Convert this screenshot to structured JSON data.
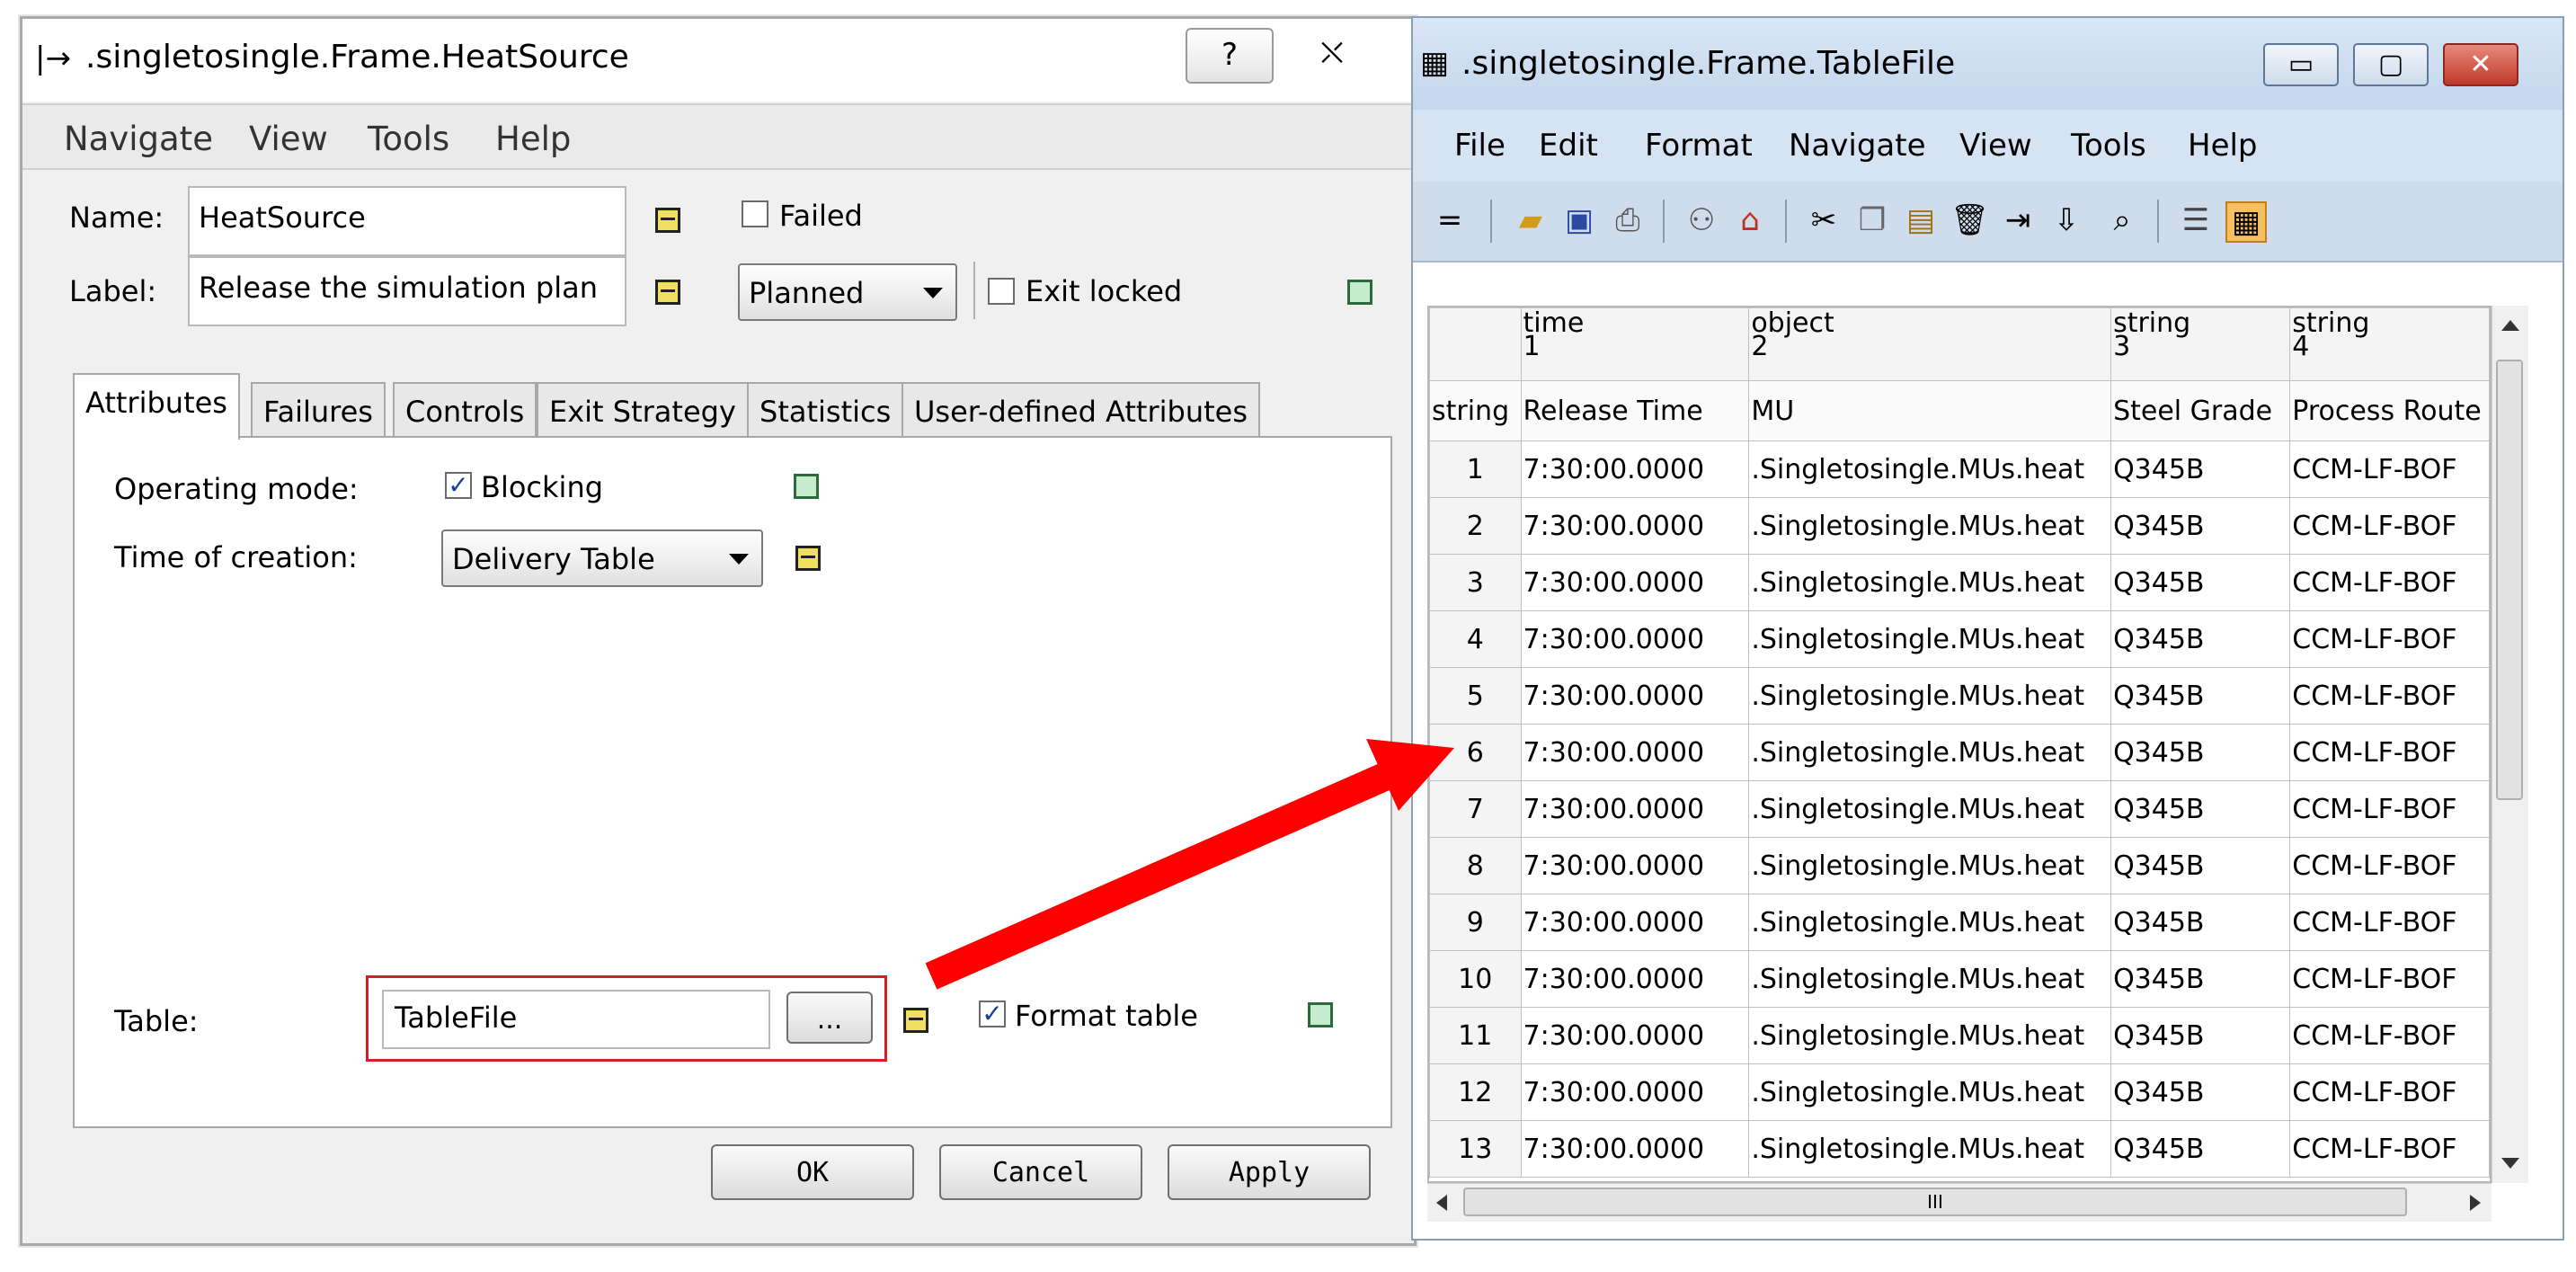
{
  "dialog": {
    "title": ".singletosingle.Frame.HeatSource",
    "help_btn": "?",
    "close_btn": "⛌",
    "menu": [
      "Navigate",
      "View",
      "Tools",
      "Help"
    ],
    "name_label": "Name:",
    "name_value": "HeatSource",
    "label_label": "Label:",
    "label_value": "Release the simulation plan",
    "failed_label": "Failed",
    "status_value": "Planned",
    "exit_locked_label": "Exit locked",
    "tabs": [
      "Attributes",
      "Failures",
      "Controls",
      "Exit Strategy",
      "Statistics",
      "User-defined Attributes"
    ],
    "operating_mode_label": "Operating mode:",
    "blocking_label": "Blocking",
    "time_creation_label": "Time of creation:",
    "time_creation_value": "Delivery Table",
    "table_label": "Table:",
    "table_value": "TableFile",
    "browse_label": "...",
    "format_table_label": "Format table",
    "buttons": {
      "ok": "OK",
      "cancel": "Cancel",
      "apply": "Apply"
    }
  },
  "window": {
    "title": ".singletosingle.Frame.TableFile",
    "menu": [
      "File",
      "Edit",
      "Format",
      "Navigate",
      "View",
      "Tools",
      "Help"
    ],
    "columns": [
      {
        "type": "time",
        "index": "1",
        "name": "Release Time"
      },
      {
        "type": "object",
        "index": "2",
        "name": "MU"
      },
      {
        "type": "string",
        "index": "3",
        "name": "Steel Grade"
      },
      {
        "type": "string",
        "index": "4",
        "name": "Process Route"
      }
    ],
    "row_header_type": "string",
    "rows": [
      [
        "1",
        "7:30:00.0000",
        ".Singletosingle.MUs.heat",
        "Q345B",
        "CCM-LF-BOF"
      ],
      [
        "2",
        "7:30:00.0000",
        ".Singletosingle.MUs.heat",
        "Q345B",
        "CCM-LF-BOF"
      ],
      [
        "3",
        "7:30:00.0000",
        ".Singletosingle.MUs.heat",
        "Q345B",
        "CCM-LF-BOF"
      ],
      [
        "4",
        "7:30:00.0000",
        ".Singletosingle.MUs.heat",
        "Q345B",
        "CCM-LF-BOF"
      ],
      [
        "5",
        "7:30:00.0000",
        ".Singletosingle.MUs.heat",
        "Q345B",
        "CCM-LF-BOF"
      ],
      [
        "6",
        "7:30:00.0000",
        ".Singletosingle.MUs.heat",
        "Q345B",
        "CCM-LF-BOF"
      ],
      [
        "7",
        "7:30:00.0000",
        ".Singletosingle.MUs.heat",
        "Q345B",
        "CCM-LF-BOF"
      ],
      [
        "8",
        "7:30:00.0000",
        ".Singletosingle.MUs.heat",
        "Q345B",
        "CCM-LF-BOF"
      ],
      [
        "9",
        "7:30:00.0000",
        ".Singletosingle.MUs.heat",
        "Q345B",
        "CCM-LF-BOF"
      ],
      [
        "10",
        "7:30:00.0000",
        ".Singletosingle.MUs.heat",
        "Q345B",
        "CCM-LF-BOF"
      ],
      [
        "11",
        "7:30:00.0000",
        ".Singletosingle.MUs.heat",
        "Q345B",
        "CCM-LF-BOF"
      ],
      [
        "12",
        "7:30:00.0000",
        ".Singletosingle.MUs.heat",
        "Q345B",
        "CCM-LF-BOF"
      ],
      [
        "13",
        "7:30:00.0000",
        ".Singletosingle.MUs.heat",
        "Q345B",
        "CCM-LF-BOF"
      ]
    ],
    "hscroll_thumb": "III"
  },
  "colors": {
    "arrow": "#ff0000",
    "highlight_box": "#d42020",
    "title_bar_right": "#c8daef"
  }
}
